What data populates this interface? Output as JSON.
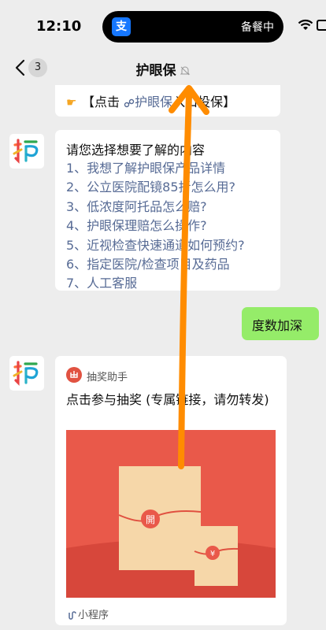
{
  "status_bar": {
    "time": "12:10",
    "activity_app_icon": "支",
    "activity_text": "备餐中"
  },
  "nav": {
    "unread_count": "3",
    "title": "护眼保"
  },
  "messages": {
    "top_bubble": {
      "prefix": "【点击",
      "link_text": "护眼保",
      "hidden_text": "入口",
      "after_hidden": "入口投保】"
    },
    "menu": {
      "title": "请您选择想要了解的内容",
      "items": [
        "1、我想了解护眼保产品详情",
        "2、公立医院配镜85折怎么用?",
        "3、低浓度阿托品怎么赔?",
        "4、护眼保理赔怎么操作?",
        "5、近视检查快速通道如何预约?",
        "6、指定医院/检查项目及药品",
        "7、人工客服"
      ]
    },
    "my_message": "度数加深",
    "mini_program_card": {
      "source_icon": "出",
      "source_name": "抽奖助手",
      "title": "点击参与抽奖 (专属链接，请勿转发)",
      "envelope_big_label": "開",
      "envelope_small_label": "¥",
      "footer": "小程序"
    }
  },
  "colors": {
    "link": "#576b95",
    "sent_bubble": "#95ec69",
    "annotation_arrow": "#ff8c00",
    "card_bg": "#e9594a"
  }
}
